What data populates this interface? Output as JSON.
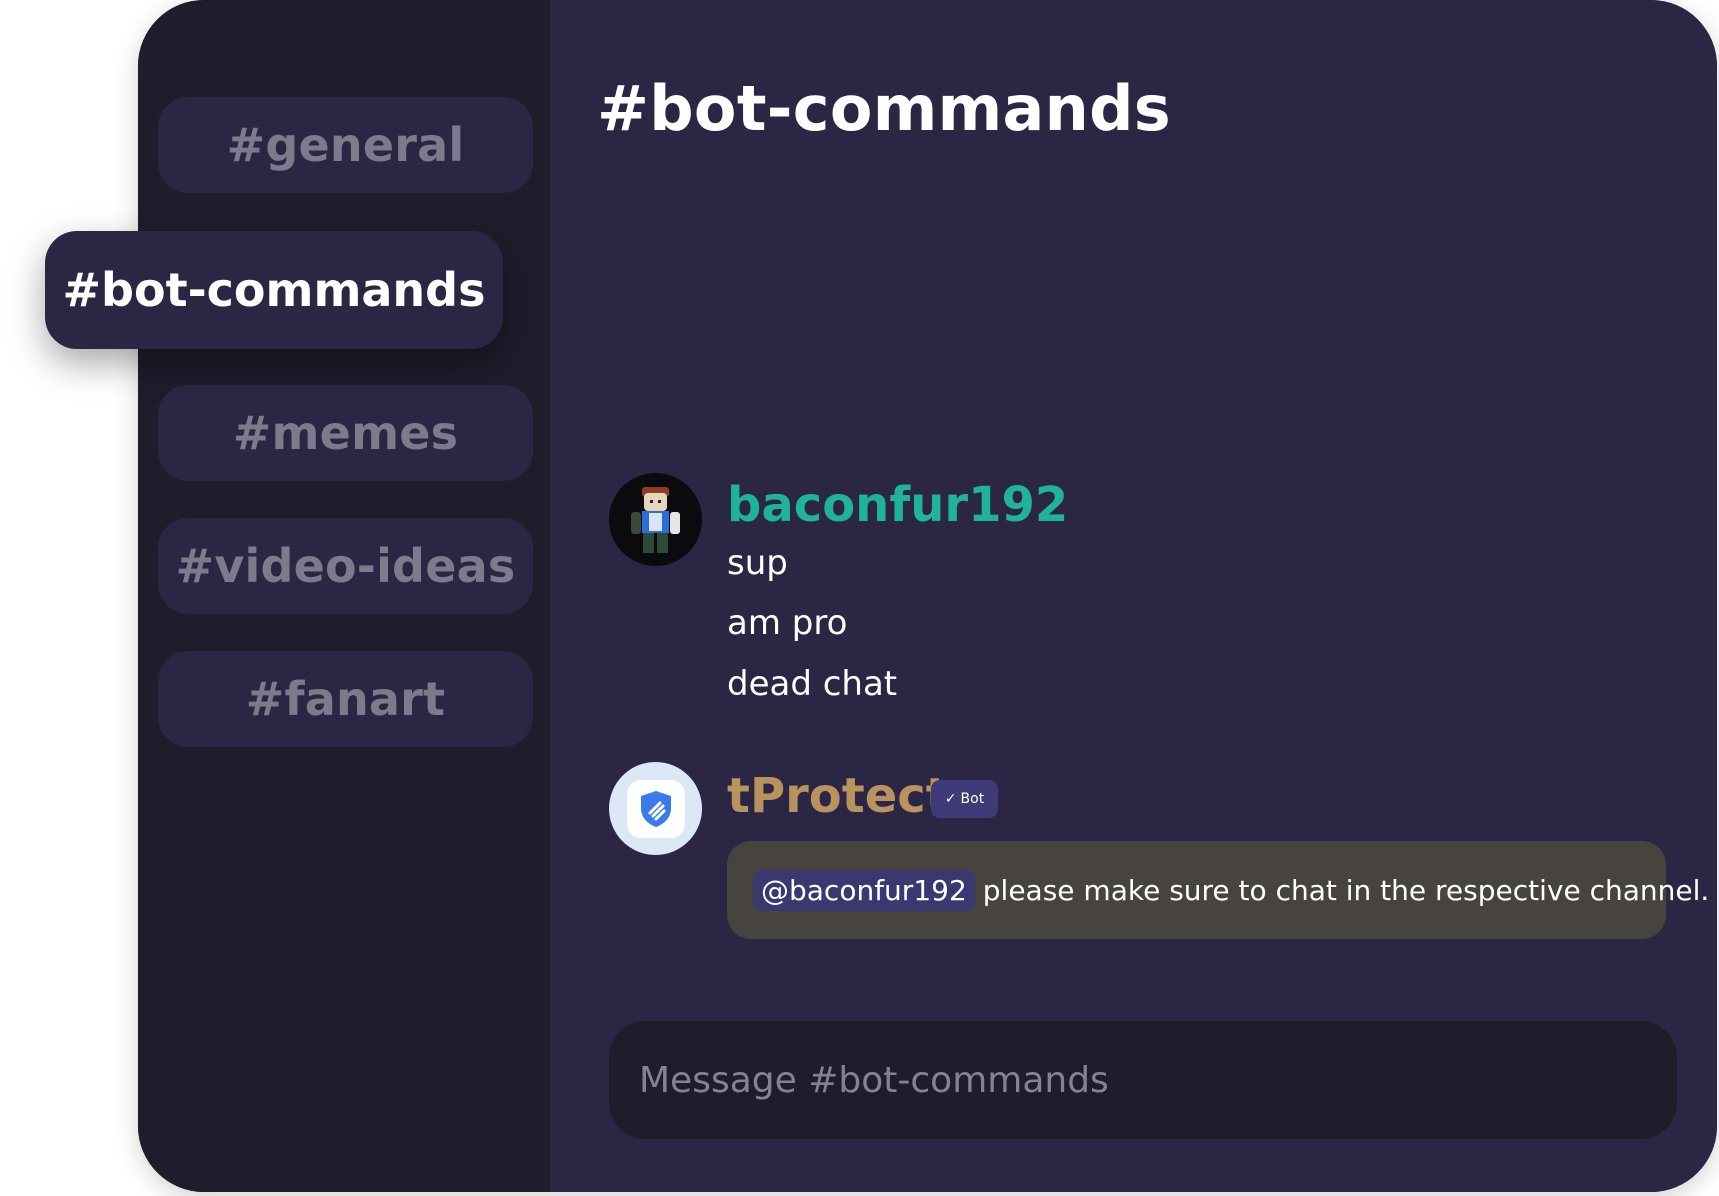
{
  "sidebar": {
    "channels": [
      {
        "label": "#general",
        "active": false
      },
      {
        "label": "#bot-commands",
        "active": true
      },
      {
        "label": "#memes",
        "active": false
      },
      {
        "label": "#video-ideas",
        "active": false
      },
      {
        "label": "#fanart",
        "active": false
      }
    ]
  },
  "header": {
    "title": "#bot-commands"
  },
  "messages": [
    {
      "author": "baconfur192",
      "author_color": "#1fb39a",
      "avatar_icon": "roblox-character-avatar",
      "lines": [
        "sup",
        "am pro",
        "dead chat"
      ]
    },
    {
      "author": "tProtect",
      "author_color": "#b8935e",
      "avatar_icon": "shield-icon",
      "badge": "Bot",
      "badge_icon": "checkmark-icon",
      "mention": "@baconfur192",
      "text": "please make sure to chat in the respective channel."
    }
  ],
  "composer": {
    "placeholder": "Message #bot-commands"
  },
  "colors": {
    "sidebar_bg": "#1f1c2c",
    "main_bg": "#2c2645",
    "bubble_bg": "#47433e",
    "mention_bg": "#3a3870",
    "badge_bg": "#3f3a78"
  }
}
